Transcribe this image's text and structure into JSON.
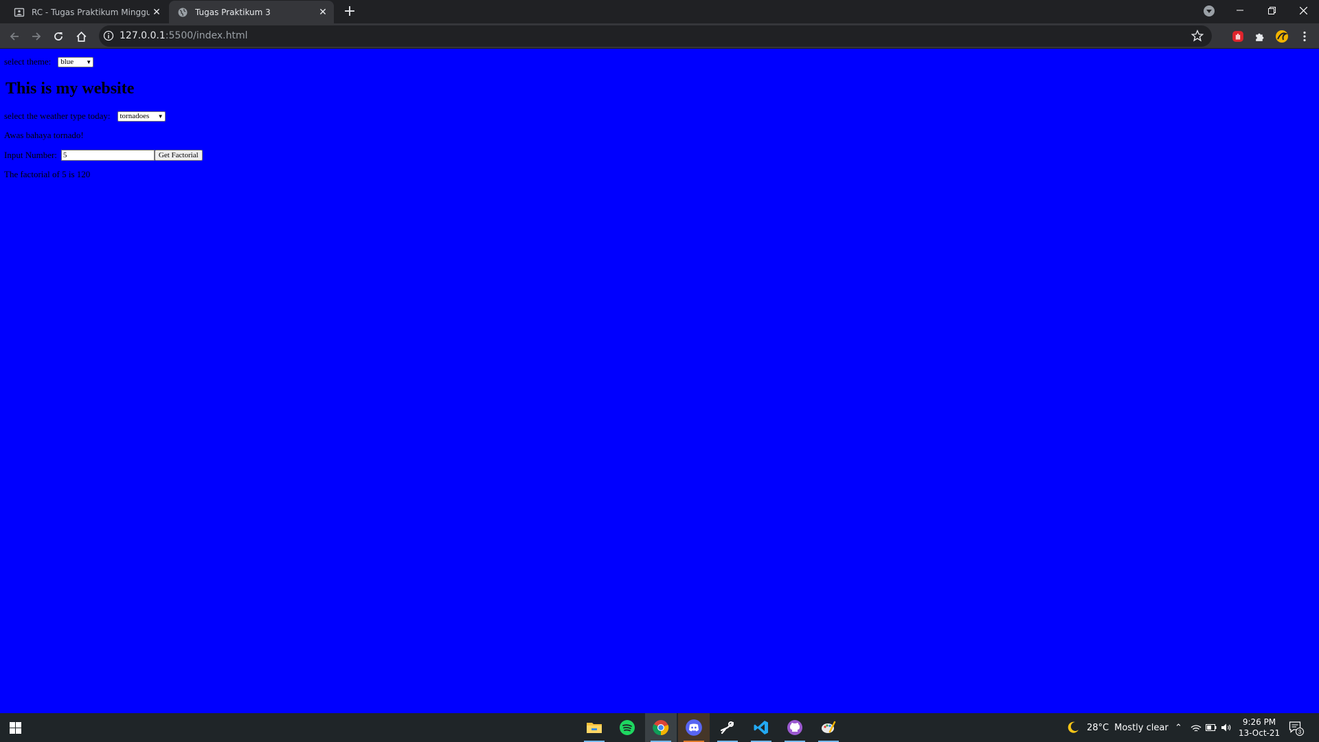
{
  "browser": {
    "tabs": [
      {
        "title": "RC - Tugas Praktikum Minggu 3",
        "active": false
      },
      {
        "title": "Tugas Praktikum 3",
        "active": true
      }
    ],
    "address": {
      "host": "127.0.0.1",
      "path": ":5500/index.html"
    }
  },
  "page": {
    "theme_label": "select theme:",
    "theme_value": "blue",
    "heading": "This is my website",
    "weather_label": "select the weather type today:",
    "weather_value": "tornadoes",
    "weather_message": "Awas bahaya tornado!",
    "input_label": "Input Number:",
    "input_value": "5",
    "button_label": "Get Factorial",
    "result_text": "The factorial of 5 is 120",
    "background_color": "#0000ff"
  },
  "taskbar": {
    "apps": [
      "file-explorer-icon",
      "spotify-icon",
      "chrome-icon",
      "discord-icon",
      "steam-icon",
      "vscode-icon",
      "github-desktop-icon",
      "paint-icon"
    ],
    "weather": {
      "temp": "28°C",
      "condition": "Mostly clear"
    },
    "time": "9:26 PM",
    "date": "13-Oct-21",
    "notification_count": "3"
  }
}
